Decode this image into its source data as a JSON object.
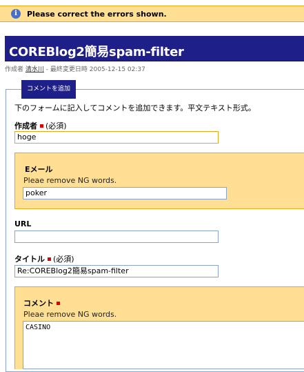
{
  "status": {
    "message": "Please correct the errors shown.",
    "icon": "info-icon"
  },
  "header": {
    "title": "COREBlog2簡易spam-filter"
  },
  "meta": {
    "author_label": "作成者",
    "author_name": "清水川",
    "modified_label": " - 最終変更日時 ",
    "modified": "2005-12-15 02:37"
  },
  "form": {
    "legend": "コメントを追加",
    "intro": "下のフォームに記入してコメントを追加できます。平文テキスト形式。",
    "required_text": "(必須)",
    "author": {
      "label": "作成者",
      "value": "hoge"
    },
    "email": {
      "label": "Eメール",
      "error": "Pleae remove NG words.",
      "value": "poker"
    },
    "url": {
      "label": "URL",
      "value": ""
    },
    "title": {
      "label": "タイトル",
      "value": "Re:COREBlog2簡易spam-filter"
    },
    "comment": {
      "label": "コメント",
      "error": "Pleae remove NG words.",
      "value": "CASINO"
    }
  },
  "colors": {
    "accent": "#1f1f8a",
    "error_bg": "#ffdf94",
    "error_border": "#e6a817",
    "required": "#dd0000"
  }
}
